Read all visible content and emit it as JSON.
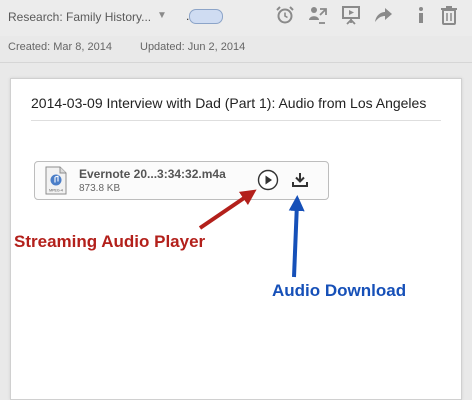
{
  "toolbar": {
    "notebook": "Research: Family History...",
    "ellipsis": "...",
    "icons": [
      "reminder-icon",
      "share-icon",
      "presentation-icon",
      "forward-icon",
      "info-icon",
      "trash-icon"
    ]
  },
  "meta": {
    "created": "Created: Mar 8, 2014",
    "updated": "Updated: Jun 2, 2014"
  },
  "note": {
    "title": "2014-03-09 Interview with Dad (Part 1): Audio from Los Angeles"
  },
  "attachment": {
    "icon_text": "MPEG-4",
    "file_name": "Evernote 20...3:34:32.m4a",
    "file_size": "873.8 KB"
  },
  "annotations": {
    "streaming": "Streaming Audio Player",
    "download": "Audio Download"
  },
  "colors": {
    "stream_arrow": "#b3201b",
    "download_arrow": "#1650b8",
    "toolbar_icon": "#8a8a8a"
  }
}
